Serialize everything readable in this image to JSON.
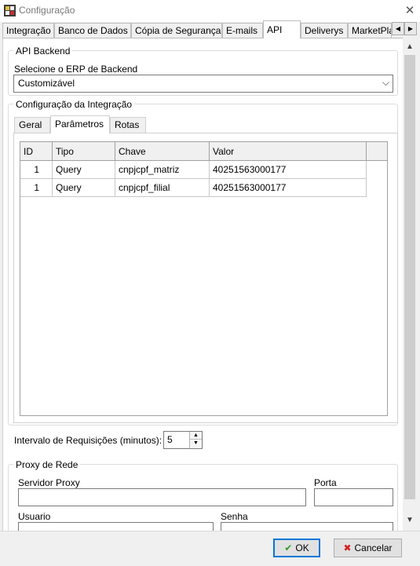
{
  "window": {
    "title": "Configuração",
    "close_glyph": "✕"
  },
  "tabs": [
    {
      "label": "Integração"
    },
    {
      "label": "Banco de Dados"
    },
    {
      "label": "Cópia de Segurança"
    },
    {
      "label": "E-mails"
    },
    {
      "label": "API",
      "active": true
    },
    {
      "label": "Deliverys"
    },
    {
      "label": "MarketPla"
    }
  ],
  "tab_scroll": {
    "left": "◀",
    "right": "▶"
  },
  "api_backend": {
    "group_title": "API Backend",
    "erp_label": "Selecione o ERP de Backend",
    "erp_value": "Customizável",
    "dropdown_glyph": "⌵"
  },
  "integration": {
    "group_title": "Configuração da Integração",
    "tabs": [
      {
        "label": "Geral"
      },
      {
        "label": "Parâmetros",
        "active": true
      },
      {
        "label": "Rotas"
      }
    ],
    "grid": {
      "headers": [
        "ID",
        "Tipo",
        "Chave",
        "Valor"
      ],
      "rows": [
        {
          "id": "1",
          "tipo": "Query",
          "chave": "cnpjcpf_matriz",
          "valor": "40251563000177"
        },
        {
          "id": "1",
          "tipo": "Query",
          "chave": "cnpjcpf_filial",
          "valor": "40251563000177"
        }
      ]
    }
  },
  "interval": {
    "label": "Intervalo de Requisições (minutos):",
    "value": "5",
    "up": "▲",
    "down": "▼"
  },
  "proxy": {
    "group_title": "Proxy de Rede",
    "server_label": "Servidor Proxy",
    "server_value": "",
    "port_label": "Porta",
    "port_value": "",
    "user_label": "Usuario",
    "user_value": "",
    "password_label": "Senha",
    "password_value": ""
  },
  "scrollbar": {
    "up": "▲",
    "down": "▼"
  },
  "footer": {
    "ok_label": "OK",
    "ok_icon": "✔",
    "cancel_label": "Cancelar",
    "cancel_icon": "✖"
  },
  "colors": {
    "accent": "#0078d7",
    "ok_icon": "#2e9b2e",
    "cancel_icon": "#d42020"
  }
}
